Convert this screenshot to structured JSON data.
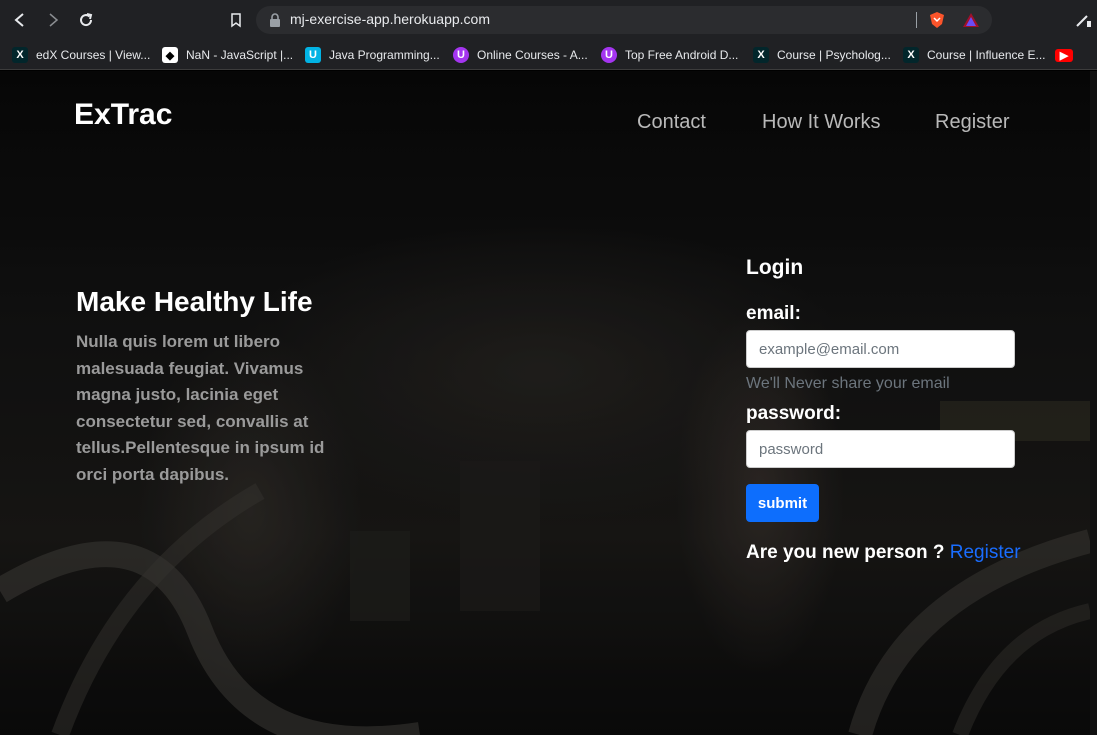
{
  "browser": {
    "url": "mj-exercise-app.herokuapp.com",
    "bookmarks": [
      {
        "label": "edX Courses | View...",
        "icon": "edx-icon"
      },
      {
        "label": "NaN - JavaScript |...",
        "icon": "mdn-icon"
      },
      {
        "label": "Java Programming...",
        "icon": "udacity-icon"
      },
      {
        "label": "Online Courses - A...",
        "icon": "udemy-icon"
      },
      {
        "label": "Top Free Android D...",
        "icon": "udemy-icon"
      },
      {
        "label": "Course | Psycholog...",
        "icon": "edx-icon"
      },
      {
        "label": "Course | Influence E...",
        "icon": "edx-icon"
      }
    ]
  },
  "header": {
    "brand": "ExTrac",
    "nav": [
      "Contact",
      "How It Works",
      "Register"
    ]
  },
  "hero": {
    "title": "Make Healthy Life",
    "text": "Nulla quis lorem ut libero malesuada feugiat. Vivamus magna justo, lacinia eget consectetur sed, convallis at tellus.Pellentesque in ipsum id orci porta dapibus."
  },
  "login": {
    "title": "Login",
    "email_label": "email:",
    "email_placeholder": "example@email.com",
    "email_hint": "We'll Never share your email",
    "password_label": "password:",
    "password_placeholder": "password",
    "submit_label": "submit",
    "new_person_text": "Are you new person ?",
    "register_link": "Register"
  },
  "colors": {
    "accent": "#0d6efd",
    "link": "#1a6dff",
    "muted": "#6c757d"
  }
}
